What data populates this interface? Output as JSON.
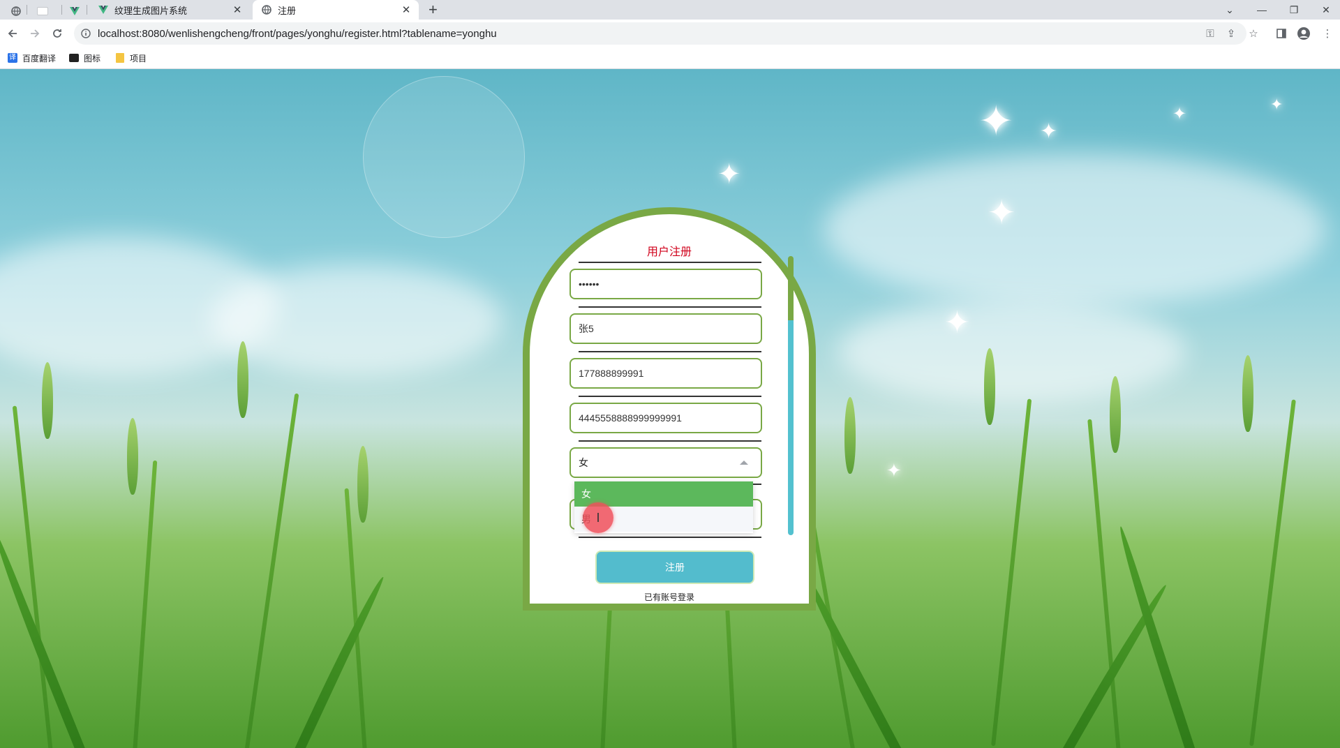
{
  "browser": {
    "tabs": [
      {
        "title": "纹理生成图片系统",
        "close": "✕"
      },
      {
        "title": "注册",
        "close": "✕"
      }
    ],
    "new_tab": "+",
    "window_controls": {
      "minimize": "—",
      "restore": "❐",
      "close": "✕"
    },
    "url": "localhost:8080/wenlishengcheng/front/pages/yonghu/register.html?tablename=yonghu",
    "bookmarks": [
      {
        "label": "百度翻译",
        "icon": "translate-icon"
      },
      {
        "label": "图标",
        "icon": "image-icon"
      },
      {
        "label": "项目",
        "icon": "folder-icon"
      }
    ]
  },
  "form": {
    "title": "用户注册",
    "fields": [
      {
        "value": "••••••"
      },
      {
        "value": "张5"
      },
      {
        "value": "177888899991"
      },
      {
        "value": "4445558888999999991"
      }
    ],
    "gender": {
      "selected": "女",
      "options": [
        "女",
        "男"
      ],
      "highlighted": "女",
      "hovered": "男"
    },
    "submit_label": "注册",
    "login_link": "已有账号登录"
  },
  "colors": {
    "panel_border": "#79a845",
    "title": "#d0021b",
    "submit": "#53bccd",
    "option_selected": "#5cb85c"
  }
}
